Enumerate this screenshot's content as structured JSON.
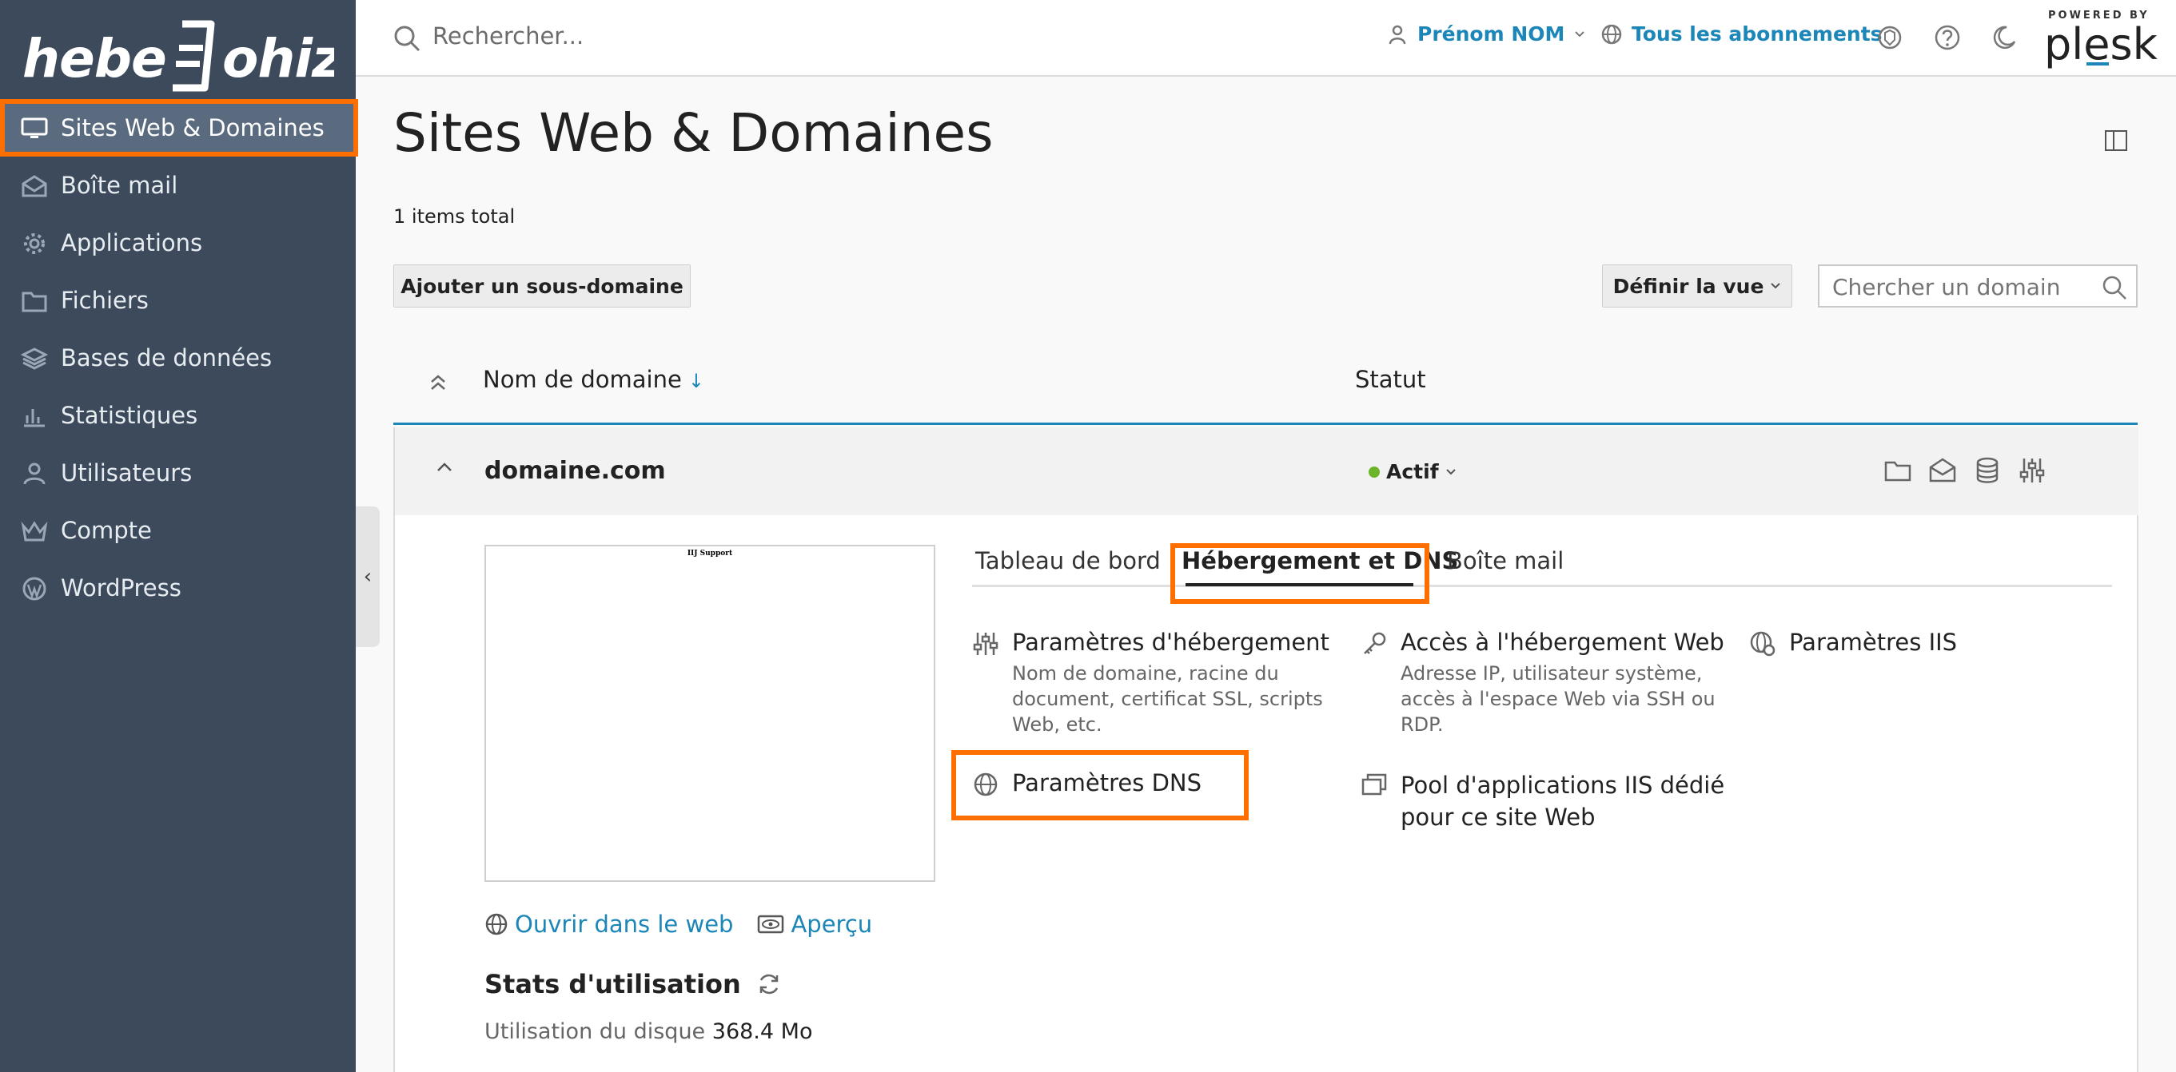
{
  "brand": {
    "logo_text": "hebe≡Johiz",
    "powered_by": "POWERED BY",
    "plesk": "plesk"
  },
  "sidebar": {
    "items": [
      {
        "label": "Sites Web & Domaines",
        "icon": "monitor-icon",
        "active": true
      },
      {
        "label": "Boîte mail",
        "icon": "mail-icon"
      },
      {
        "label": "Applications",
        "icon": "gear-icon"
      },
      {
        "label": "Fichiers",
        "icon": "folder-icon"
      },
      {
        "label": "Bases de données",
        "icon": "database-icon"
      },
      {
        "label": "Statistiques",
        "icon": "bar-chart-icon"
      },
      {
        "label": "Utilisateurs",
        "icon": "user-icon"
      },
      {
        "label": "Compte",
        "icon": "crown-icon"
      },
      {
        "label": "WordPress",
        "icon": "wordpress-icon"
      }
    ],
    "collapse_glyph": "‹"
  },
  "topbar": {
    "search_placeholder": "Rechercher...",
    "user_name": "Prénom NOM",
    "subscriptions": "Tous les abonnements"
  },
  "page": {
    "title": "Sites Web & Domaines",
    "items_total": "1 items total",
    "add_subdomain": "Ajouter un sous-domaine",
    "define_view": "Définir la vue",
    "domain_search_placeholder": "Chercher un domain"
  },
  "list": {
    "col_name": "Nom de domaine",
    "col_name_sort": "↓",
    "col_status": "Statut"
  },
  "row": {
    "domain": "domaine.com",
    "status": "Actif",
    "preview_label": "IIJ Support",
    "open_web": "Ouvrir dans le web",
    "preview": "Aperçu",
    "stats_title": "Stats d'utilisation",
    "disk_label": "Utilisation du disque",
    "disk_value": "368.4 Mo"
  },
  "tabs": [
    "Tableau de bord",
    "Hébergement et DNS",
    "Boîte mail"
  ],
  "tools": [
    {
      "title": "Paramètres d'hébergement",
      "desc": "Nom de domaine, racine du document, certificat SSL, scripts Web, etc.",
      "icon": "sliders-icon"
    },
    {
      "title": "Accès à l'hébergement Web",
      "desc": "Adresse IP, utilisateur système, accès à l'espace Web via SSH ou RDP.",
      "icon": "key-icon"
    },
    {
      "title": "Paramètres IIS",
      "desc": "",
      "icon": "globe-gear-icon"
    },
    {
      "title": "Paramètres DNS",
      "desc": "",
      "icon": "globe-icon"
    },
    {
      "title": "Pool d'applications IIS dédié pour ce site Web",
      "desc": "",
      "icon": "windows-icon"
    }
  ],
  "colors": {
    "sidebar": "#3c4a5c",
    "accent": "#1b86b7",
    "highlight": "#ff6f00",
    "active_dot": "#6bb52a"
  }
}
